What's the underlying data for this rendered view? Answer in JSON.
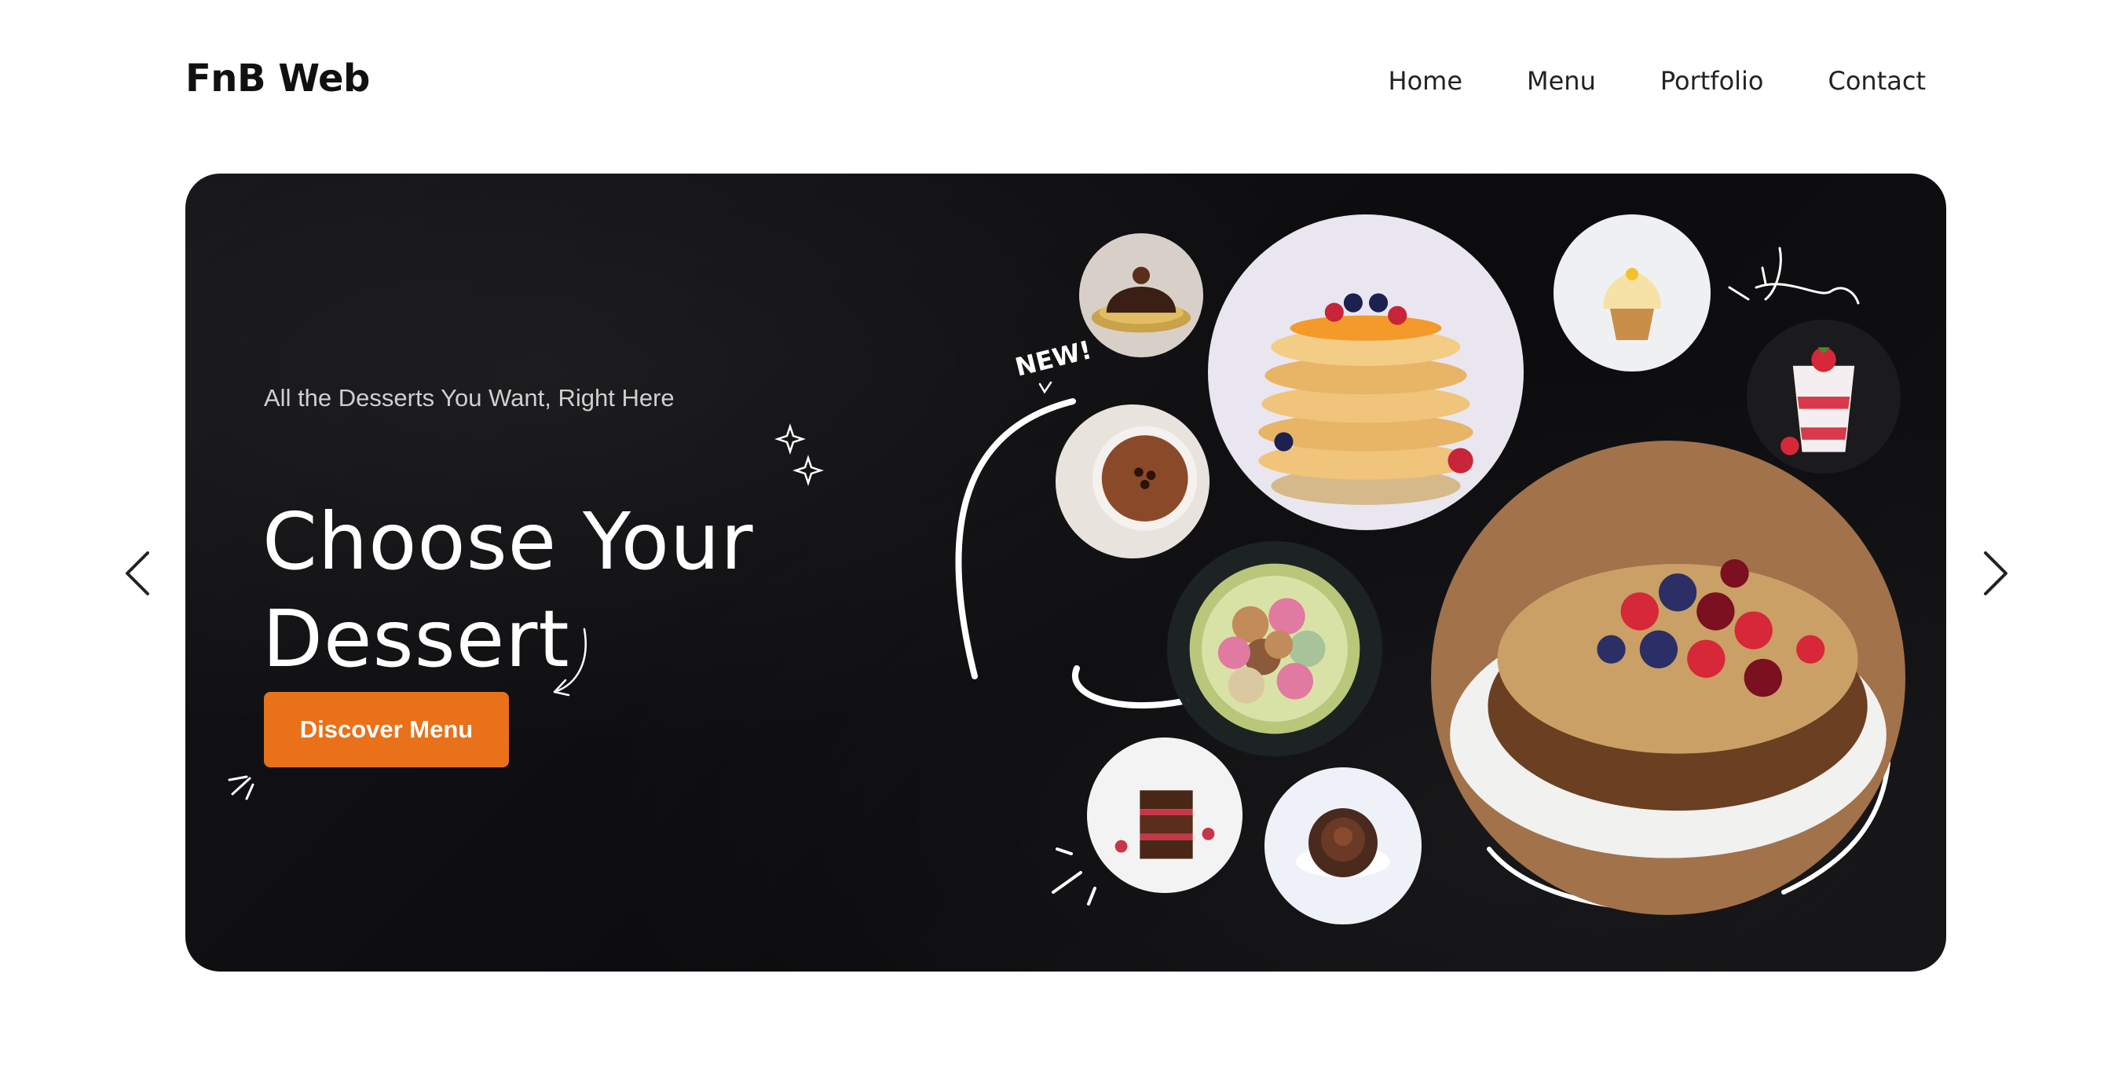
{
  "header": {
    "logo": "FnB Web",
    "nav": [
      "Home",
      "Menu",
      "Portfolio",
      "Contact"
    ]
  },
  "hero": {
    "subtitle": "All the Desserts You Want, Right Here",
    "title": "Choose Your Dessert",
    "cta_label": "Discover Menu",
    "new_badge": "NEW!",
    "accent_color": "#e8711a",
    "background_color": "#0e0e10",
    "images": [
      "chocolate-dome-cake",
      "pancake-stack",
      "vanilla-cupcake",
      "strawberry-parfait",
      "tiramisu-cup",
      "macarons-bowl",
      "berry-caramel-cake",
      "chocolate-brownie-stack",
      "chocolate-cupcake"
    ]
  },
  "carousel": {
    "prev_icon": "chevron-left-icon",
    "next_icon": "chevron-right-icon"
  }
}
